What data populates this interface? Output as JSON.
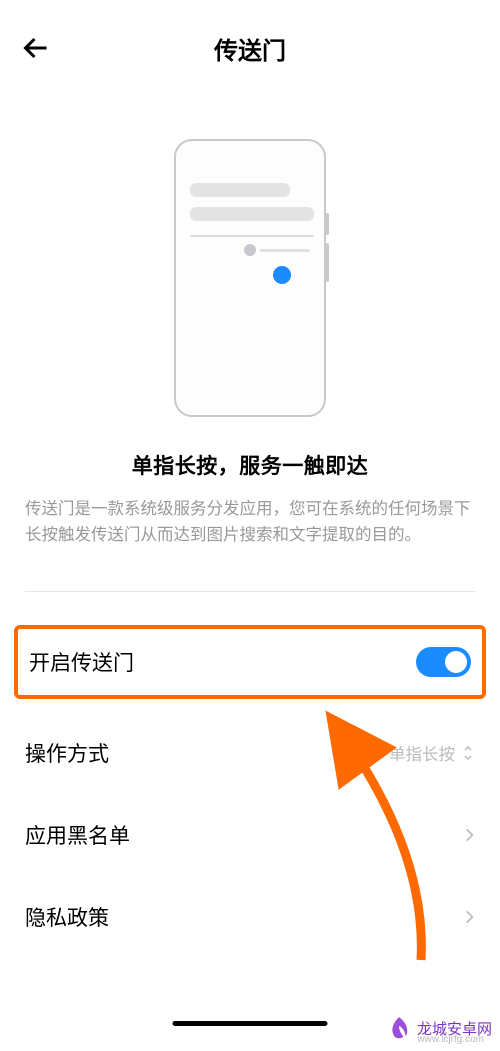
{
  "header": {
    "title": "传送门"
  },
  "illustration": {
    "caption": "单指长按，服务一触即达",
    "description": "传送门是一款系统级服务分发应用，您可在系统的任何场景下长按触发传送门从而达到图片搜索和文字提取的目的。"
  },
  "settings": {
    "enable": {
      "label": "开启传送门",
      "on": true
    },
    "method": {
      "label": "操作方式",
      "value": "单指长按"
    },
    "blacklist": {
      "label": "应用黑名单"
    },
    "privacy": {
      "label": "隐私政策"
    }
  },
  "watermark": {
    "name": "龙城安卓网",
    "url": "www.lcjrfg.com"
  }
}
